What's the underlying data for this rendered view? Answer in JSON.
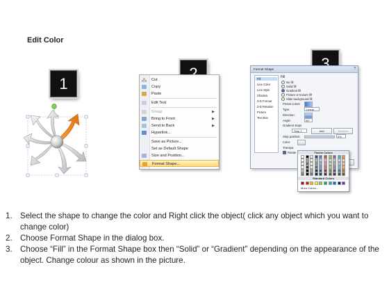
{
  "heading": "Edit Color",
  "steps": [
    "1",
    "2",
    "3"
  ],
  "context_menu": {
    "items": [
      {
        "label": "Cut",
        "icon": "scissors-icon",
        "dim": false,
        "arrow": false
      },
      {
        "label": "Copy",
        "icon": "copy-icon",
        "dim": false,
        "arrow": false
      },
      {
        "label": "Paste",
        "icon": "paste-icon",
        "dim": false,
        "arrow": false
      },
      {
        "label": "Edit Text",
        "icon": "edit-text-icon",
        "dim": false,
        "arrow": false
      },
      {
        "label": "Group",
        "icon": "group-icon",
        "dim": true,
        "arrow": true
      },
      {
        "label": "Bring to Front",
        "icon": "bring-front-icon",
        "dim": false,
        "arrow": true
      },
      {
        "label": "Send to Back",
        "icon": "send-back-icon",
        "dim": false,
        "arrow": true
      },
      {
        "label": "Hyperlink...",
        "icon": "hyperlink-icon",
        "dim": false,
        "arrow": false
      },
      {
        "label": "Save as Picture...",
        "icon": "",
        "dim": false,
        "arrow": false
      },
      {
        "label": "Set as Default Shape",
        "icon": "",
        "dim": false,
        "arrow": false
      },
      {
        "label": "Size and Position...",
        "icon": "size-icon",
        "dim": false,
        "arrow": false
      },
      {
        "label": "Format Shape...",
        "icon": "format-shape-icon",
        "dim": false,
        "arrow": false
      }
    ]
  },
  "dialog": {
    "title": "Format Shape",
    "nav": [
      "Fill",
      "Line Color",
      "Line Style",
      "Shadow",
      "3-D Format",
      "3-D Rotation",
      "Picture",
      "Text Box"
    ],
    "fill_heading": "Fill",
    "fill_options": [
      "No fill",
      "Solid fill",
      "Gradient fill",
      "Picture or texture fill",
      "Slide background fill"
    ],
    "preset_label": "Preset colors:",
    "type_label": "Type:",
    "type_value": "Linear",
    "direction_label": "Direction:",
    "angle_label": "Angle:",
    "angle_value": "90°",
    "stops_label": "Gradient stops",
    "stop_value": "Stop 1",
    "add_label": "Add",
    "remove_label": "Remove",
    "position_label": "Stop position:",
    "position_value": "0%",
    "color_label": "Color:",
    "transparency_label": "Transpa",
    "rotate_label": "Rotate",
    "close_label": "Close"
  },
  "palette": {
    "theme_heading": "Theme Colors",
    "standard_heading": "Standard Colors",
    "more_label": "More Colors...",
    "theme_top": [
      "#ffffff",
      "#000000",
      "#eeece1",
      "#1f497d",
      "#4f81bd",
      "#c0504d",
      "#9bbb59",
      "#8064a2",
      "#4bacc6",
      "#f79646"
    ],
    "standard": [
      "#c00000",
      "#ff0000",
      "#ffc000",
      "#ffff00",
      "#92d050",
      "#00b050",
      "#00b0f0",
      "#0070c0",
      "#002060",
      "#7030a0"
    ]
  },
  "instructions": [
    {
      "num": "1.",
      "text": "Select the shape to change the color and Right click the object( click any object which you want to change color)"
    },
    {
      "num": "2.",
      "text": "Choose Format Shape in the dialog box."
    },
    {
      "num": "3.",
      "text": "Choose “Fill” in the Format Shape box then “Solid” or “Gradient” depending on the appearance of the object. Change colour as shown in the picture."
    }
  ]
}
